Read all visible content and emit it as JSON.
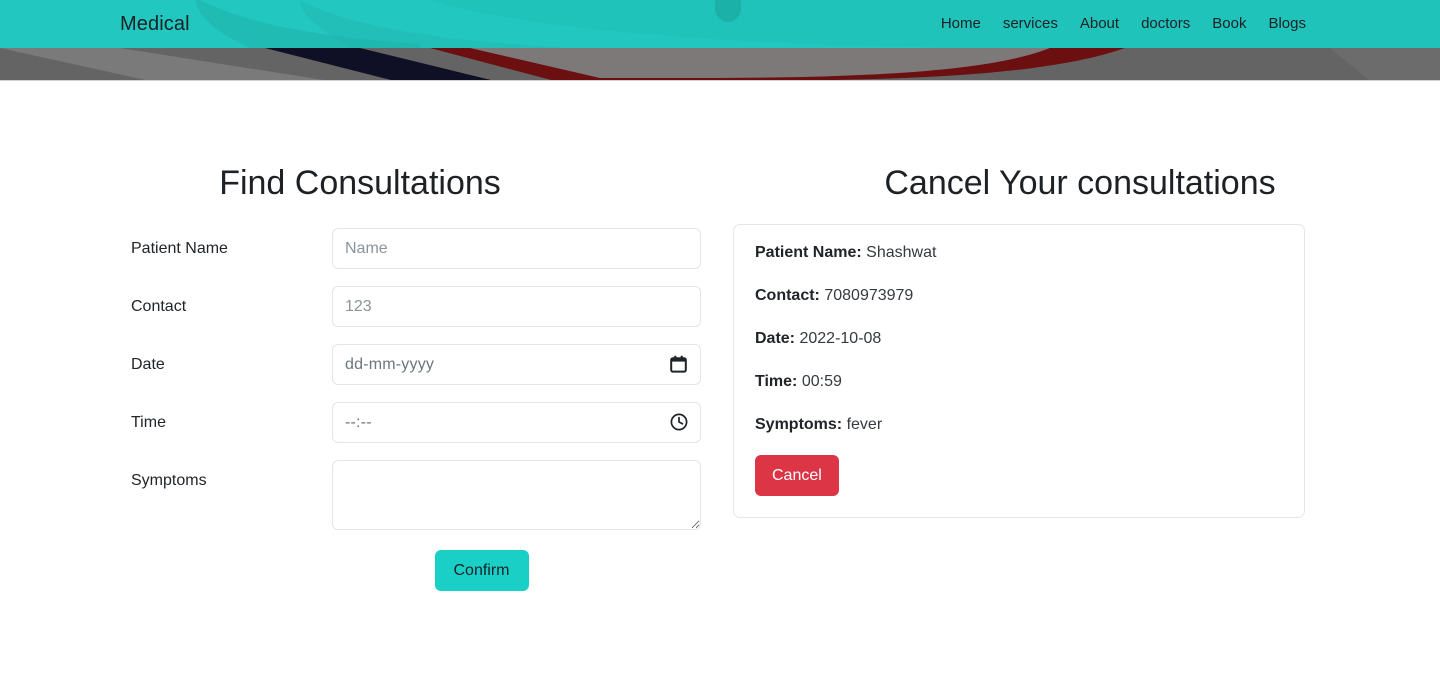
{
  "theme": {
    "navbar_teal": "#22c7bf",
    "hero_gray": "#646464",
    "hero_navy": "#0f1026",
    "hero_darkred": "#6b0f11",
    "confirm_teal": "#1ad0c6",
    "cancel_red": "#dc3545",
    "border_gray": "#e3e5e8",
    "placeholder_gray": "#8b949c"
  },
  "navbar": {
    "brand": "Medical",
    "links": [
      {
        "label": "Home"
      },
      {
        "label": "services"
      },
      {
        "label": "About"
      },
      {
        "label": "doctors"
      },
      {
        "label": "Book"
      },
      {
        "label": "Blogs"
      }
    ]
  },
  "find_form": {
    "title": "Find Consultations",
    "fields": [
      {
        "label": "Patient Name",
        "placeholder": "Name",
        "value": "",
        "icon": ""
      },
      {
        "label": "Contact",
        "placeholder": "123",
        "value": "",
        "icon": ""
      },
      {
        "label": "Date",
        "placeholder": "dd-mm-yyyy",
        "value": "",
        "icon": "calendar-icon"
      },
      {
        "label": "Time",
        "placeholder": "--:--",
        "value": "",
        "icon": "clock-icon"
      },
      {
        "label": "Symptoms",
        "placeholder": "",
        "value": "",
        "icon": ""
      }
    ],
    "submit_label": "Confirm"
  },
  "cancel_panel": {
    "title": "Cancel Your consultations",
    "record": [
      {
        "key": "Patient Name:",
        "value": "Shashwat"
      },
      {
        "key": "Contact:",
        "value": "7080973979"
      },
      {
        "key": "Date:",
        "value": "2022-10-08"
      },
      {
        "key": "Time:",
        "value": "00:59"
      },
      {
        "key": "Symptoms:",
        "value": "fever"
      }
    ],
    "cancel_label": "Cancel"
  }
}
